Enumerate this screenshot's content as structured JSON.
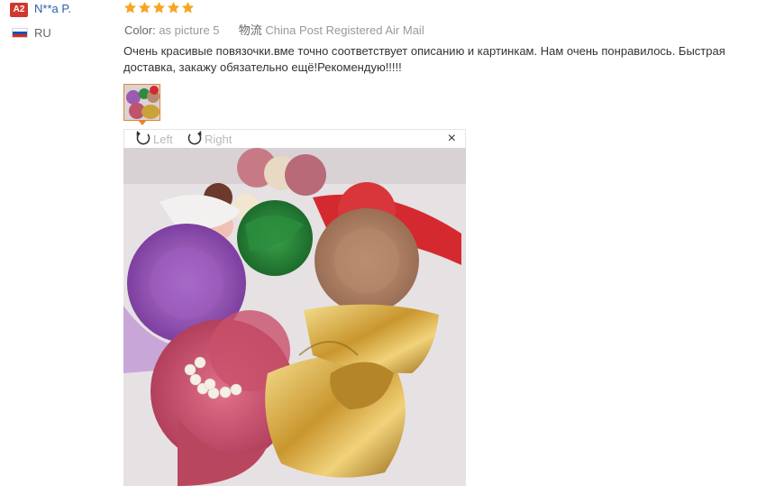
{
  "reviewer": {
    "badge": "A2",
    "name": "N**a P.",
    "country_code": "RU"
  },
  "rating": {
    "stars": 5,
    "max": 5,
    "color": "#f5a623"
  },
  "order_info": {
    "color_label": "Color:",
    "color_value": "as picture 5",
    "shipping_label": "物流",
    "shipping_value": "China Post Registered Air Mail"
  },
  "review": {
    "text": "Очень красивые повязочки.вме точно соответствует описанию и картинкам. Нам очень понравилось. Быстрая доставка, закажу обязательно ещё!Рекомендую!!!!!"
  },
  "viewer": {
    "rotate_left_label": "Left",
    "rotate_right_label": "Right",
    "close_symbol": "×"
  },
  "colors": {
    "link_blue": "#2a5fb0",
    "badge_red": "#d0382d",
    "thumb_border": "#e9822e"
  }
}
